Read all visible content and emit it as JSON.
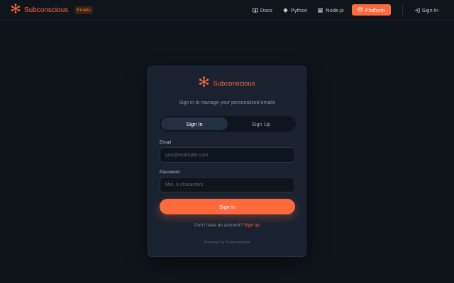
{
  "header": {
    "brand_name": "Subconscious",
    "brand_badge": "Emails",
    "nav": {
      "docs": "Docs",
      "python": "Python",
      "nodejs": "Node.js",
      "platform": "Platform",
      "signin": "Sign In"
    }
  },
  "card": {
    "brand_name": "Subconscious",
    "subtitle": "Sign in to manage your personalized emails",
    "tabs": {
      "signin": "Sign In",
      "signup": "Sign Up"
    },
    "email": {
      "label": "Email",
      "placeholder": "you@example.com"
    },
    "password": {
      "label": "Password",
      "placeholder": "Min. 8 characters"
    },
    "submit_label": "Sign In",
    "switch_text": "Don't have an account?",
    "switch_link": "Sign up",
    "powered_by": "Powered by Subconscious"
  },
  "colors": {
    "accent": "#ff6a3d",
    "background": "#0f141b",
    "card": "#1a2230"
  },
  "icons": [
    "logo-icon",
    "book-icon",
    "python-icon",
    "nodejs-icon",
    "platform-icon",
    "signin-icon"
  ]
}
